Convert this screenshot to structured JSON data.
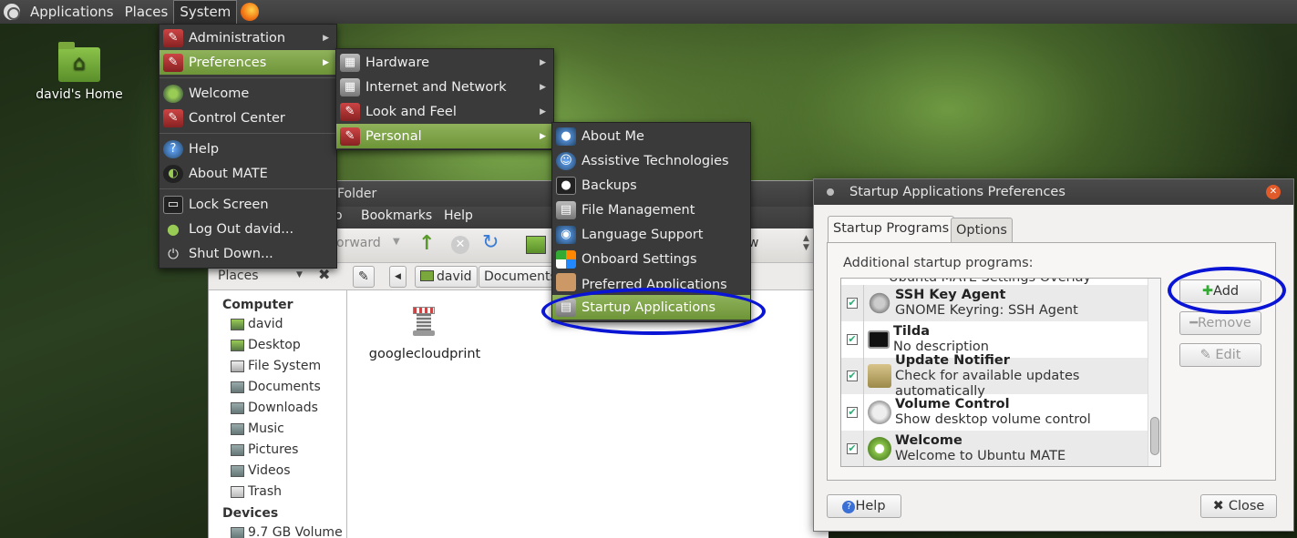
{
  "panel": {
    "applications": "Applications",
    "places": "Places",
    "system": "System"
  },
  "desktop": {
    "home_label": "david's Home"
  },
  "system_menu": {
    "items": [
      "Administration",
      "Preferences",
      "Welcome",
      "Control Center",
      "Help",
      "About MATE",
      "Lock Screen",
      "Log Out david...",
      "Shut Down..."
    ]
  },
  "preferences_menu": {
    "items": [
      "Hardware",
      "Internet and Network",
      "Look and Feel",
      "Personal"
    ]
  },
  "personal_menu": {
    "items": [
      "About Me",
      "Assistive Technologies",
      "Backups",
      "File Management",
      "Language Support",
      "Onboard Settings",
      "Preferred Applications",
      "Startup Applications"
    ]
  },
  "file_manager": {
    "title": "Folder",
    "menu": [
      "o",
      "Bookmarks",
      "Help"
    ],
    "forward": "orward",
    "view_partial": "w",
    "sidebar_header": "Places",
    "path": [
      "david",
      "Documents"
    ],
    "computer_header": "Computer",
    "places": [
      "david",
      "Desktop",
      "File System",
      "Documents",
      "Downloads",
      "Music",
      "Pictures",
      "Videos",
      "Trash"
    ],
    "devices_header": "Devices",
    "device": "9.7 GB Volume",
    "file": "googlecloudprint"
  },
  "dialog": {
    "title": "Startup Applications Preferences",
    "tabs": [
      "Startup Programs",
      "Options"
    ],
    "section_label": "Additional startup programs:",
    "partial_row": "Ubuntu MATE Settings Overlay",
    "programs": [
      {
        "name": "SSH Key Agent",
        "desc": "GNOME Keyring: SSH Agent",
        "checked": true
      },
      {
        "name": "Tilda",
        "desc": "No description",
        "checked": true
      },
      {
        "name": "Update Notifier",
        "desc": "Check for available updates automatically",
        "checked": true
      },
      {
        "name": "Volume Control",
        "desc": "Show desktop volume control",
        "checked": true
      },
      {
        "name": "Welcome",
        "desc": "Welcome to Ubuntu MATE",
        "checked": true
      }
    ],
    "buttons": {
      "add": "Add",
      "remove": "Remove",
      "edit": "Edit",
      "help": "Help",
      "close": "Close"
    }
  },
  "colors": {
    "annotation_ring": "#0a14d4",
    "menu_highlight": "#7ea34a"
  }
}
